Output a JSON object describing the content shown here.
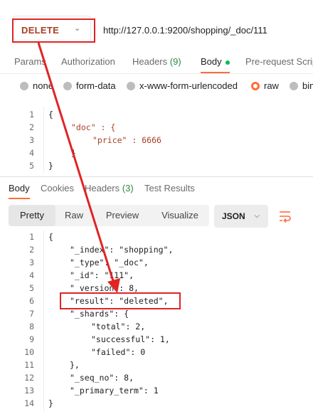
{
  "request": {
    "method": "DELETE",
    "url": "http://127.0.0.1:9200/shopping/_doc/111"
  },
  "request_tabs": [
    {
      "label": "Params"
    },
    {
      "label": "Authorization"
    },
    {
      "label": "Headers",
      "count": "(9)"
    },
    {
      "label": "Body"
    },
    {
      "label": "Pre-request Scrip"
    }
  ],
  "body_types": [
    {
      "label": "none"
    },
    {
      "label": "form-data"
    },
    {
      "label": "x-www-form-urlencoded"
    },
    {
      "label": "raw",
      "selected": true
    },
    {
      "label": "bin"
    }
  ],
  "request_body": {
    "line_numbers": [
      "1",
      "2",
      "3",
      "4",
      "5"
    ],
    "lines": [
      "{",
      "\"doc\" : {",
      "\"price\" : 6666",
      "}",
      "}"
    ]
  },
  "response_tabs": [
    {
      "label": "Body"
    },
    {
      "label": "Cookies"
    },
    {
      "label": "Headers",
      "count": "(3)"
    },
    {
      "label": "Test Results"
    }
  ],
  "view_modes": [
    {
      "label": "Pretty"
    },
    {
      "label": "Raw"
    },
    {
      "label": "Preview"
    },
    {
      "label": "Visualize"
    }
  ],
  "format_select": "JSON",
  "response_body": {
    "line_numbers": [
      "1",
      "2",
      "3",
      "4",
      "5",
      "6",
      "7",
      "8",
      "9",
      "10",
      "11",
      "12",
      "13",
      "14"
    ],
    "lines": [
      "{",
      "\"_index\": \"shopping\",",
      "\"_type\": \"_doc\",",
      "\"_id\": \"111\",",
      "\"_version\": 8,",
      "\"result\": \"deleted\",",
      "\"_shards\": {",
      "\"total\": 2,",
      "\"successful\": 1,",
      "\"failed\": 0",
      "},",
      "\"_seq_no\": 8,",
      "\"_primary_term\": 1",
      "}"
    ]
  },
  "colors": {
    "accent": "#ff6c37",
    "method": "#a93f20",
    "annotation": "#e02424",
    "number": "#0b6a8a"
  },
  "icons": {
    "wrap": "wrap-lines-icon",
    "chevron": "chevron-down-icon"
  }
}
